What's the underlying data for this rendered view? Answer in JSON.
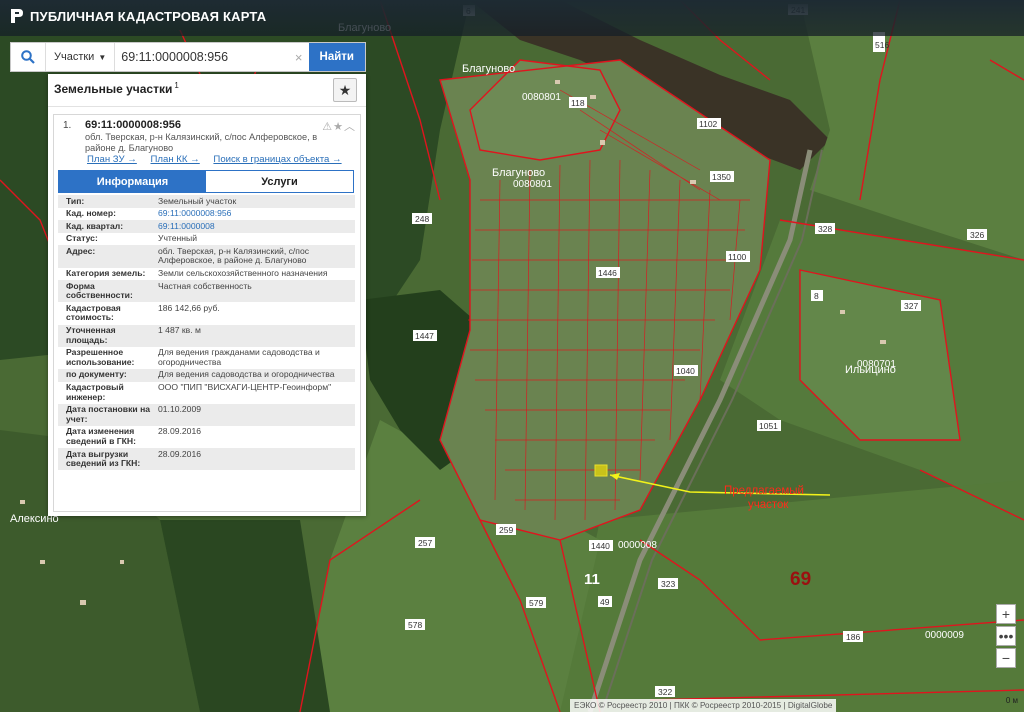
{
  "header": {
    "app_title": "ПУБЛИЧНАЯ КАДАСТРОВАЯ КАРТА"
  },
  "search": {
    "type_label": "Участки",
    "query": "69:11:0000008:956",
    "submit_label": "Найти"
  },
  "panel": {
    "title": "Земельные участки",
    "count": "1",
    "result": {
      "index": "1.",
      "cad_number": "69:11:0000008:956",
      "address": "обл. Тверская, р-н Калязинский, с/пос Алферовское, в районе д. Благуново",
      "links": [
        "План ЗУ →",
        "План КК →",
        "Поиск в границах объекта →"
      ]
    },
    "tabs": [
      "Информация",
      "Услуги"
    ],
    "rows": [
      {
        "key": "Тип:",
        "value": "Земельный участок"
      },
      {
        "key": "Кад. номер:",
        "value": "69:11:0000008:956"
      },
      {
        "key": "Кад. квартал:",
        "value": "69:11:0000008"
      },
      {
        "key": "Статус:",
        "value": "Учтенный"
      },
      {
        "key": "Адрес:",
        "value": "обл. Тверская, р-н Калязинский, с/пос Алферовское, в районе д. Благуново"
      },
      {
        "key": "Категория земель:",
        "value": "Земли сельскохозяйственного назначения"
      },
      {
        "key": "Форма собственности:",
        "value": "Частная собственность"
      },
      {
        "key": "Кадастровая стоимость:",
        "value": "186 142,66 руб."
      },
      {
        "key": "Уточненная площадь:",
        "value": "1 487 кв. м"
      },
      {
        "key": "Разрешенное использование:",
        "value": "Для ведения гражданами садоводства и огородничества"
      },
      {
        "key": "по документу:",
        "value": "Для ведения садоводства и огородничества"
      },
      {
        "key": "Кадастровый инженер:",
        "value": "ООО \"ПИП \"ВИСХАГИ-ЦЕНТР-Геоинформ\""
      },
      {
        "key": "Дата постановки на учет:",
        "value": "01.10.2009"
      },
      {
        "key": "Дата изменения сведений в ГКН:",
        "value": "28.09.2016"
      },
      {
        "key": "Дата выгрузки сведений из ГКН:",
        "value": "28.09.2016"
      }
    ]
  },
  "map": {
    "place_labels": [
      "Благуново",
      "Благуново",
      "Благуново",
      "Ильицино",
      "Алексино"
    ],
    "quarter_labels": [
      "0080801",
      "0080801",
      "0080701",
      "0000008",
      "0000009"
    ],
    "district_labels": [
      "11",
      "69"
    ],
    "parcel_labels": [
      "241",
      "516",
      "248",
      "328",
      "326",
      "327",
      "1051",
      "259",
      "257",
      "323",
      "579",
      "578",
      "186",
      "49",
      "322",
      "1102",
      "1350",
      "1100",
      "1040",
      "1447",
      "1446",
      "1440",
      "118",
      "8",
      "6"
    ],
    "annotation": "Предлагаемый участок",
    "annotation_color": "#ff2a1a",
    "arrow_color": "#f2f21a",
    "boundary_color": "#e0141e"
  },
  "controls": {
    "zoom_in": "+",
    "zoom_out": "−"
  },
  "attribution": "ЕЭКО © Росреестр 2010 | ПКК © Росреестр 2010-2015 | DigitalGlobe",
  "scale_label": "0 м"
}
